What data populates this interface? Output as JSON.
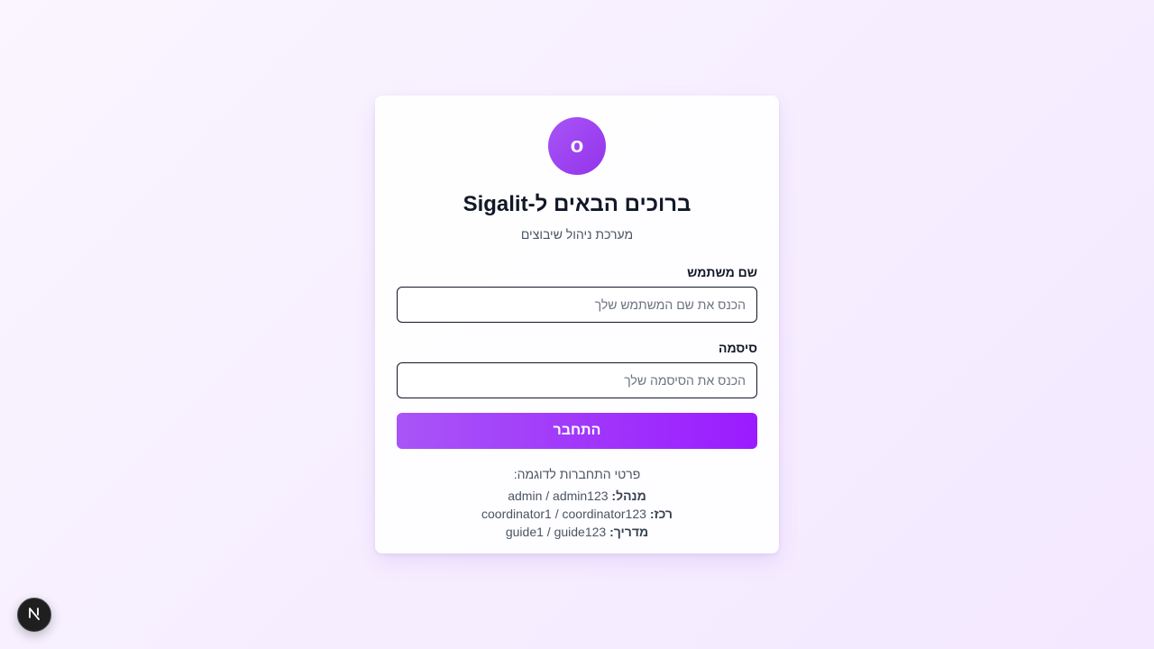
{
  "logo": {
    "letter": "o"
  },
  "header": {
    "title": "ברוכים הבאים ל-Sigalit",
    "subtitle": "מערכת ניהול שיבוצים"
  },
  "form": {
    "username": {
      "label": "שם משתמש",
      "placeholder": "הכנס את שם המשתמש שלך",
      "value": ""
    },
    "password": {
      "label": "סיסמה",
      "placeholder": "הכנס את הסיסמה שלך",
      "value": ""
    },
    "submit_label": "התחבר"
  },
  "demo": {
    "title": "פרטי התחברות לדוגמה:",
    "accounts": [
      {
        "role": "מנהל:",
        "credentials": "admin / admin123"
      },
      {
        "role": "רכז:",
        "credentials": "coordinator1 / coordinator123"
      },
      {
        "role": "מדריך:",
        "credentials": "guide1 / guide123"
      }
    ]
  },
  "dev_badge": {
    "icon": "nextjs-logo-icon",
    "letter": "N"
  },
  "colors": {
    "accent_start": "#a855f7",
    "accent_end": "#9b1bff",
    "background": "#f3e8ff"
  }
}
